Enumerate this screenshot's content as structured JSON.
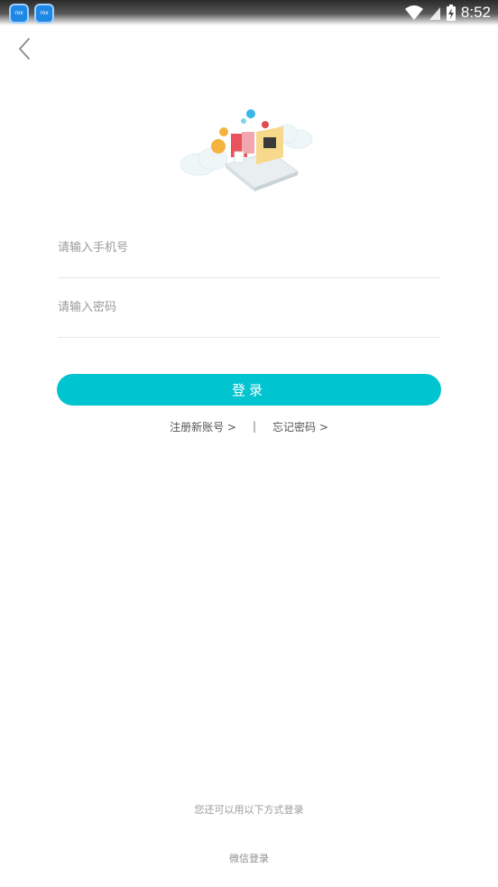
{
  "status_bar": {
    "time": "8:52",
    "app_icon_label": "rox",
    "icons": [
      "app-icon",
      "app-icon",
      "wifi-icon",
      "signal-icon",
      "battery-charging-icon"
    ]
  },
  "nav": {
    "back_icon": "chevron-left-icon"
  },
  "form": {
    "phone_placeholder": "请输入手机号",
    "password_placeholder": "请输入密码",
    "login_label": "登录"
  },
  "links": {
    "register": "注册新账号 >",
    "divider": "|",
    "forgot": "忘记密码 >"
  },
  "footer": {
    "other_methods": "您还可以用以下方式登录",
    "wechat_login": "微信登录"
  },
  "colors": {
    "accent": "#00c4cf",
    "divider_line": "#e6e6e6",
    "placeholder": "#9a9a9a"
  }
}
